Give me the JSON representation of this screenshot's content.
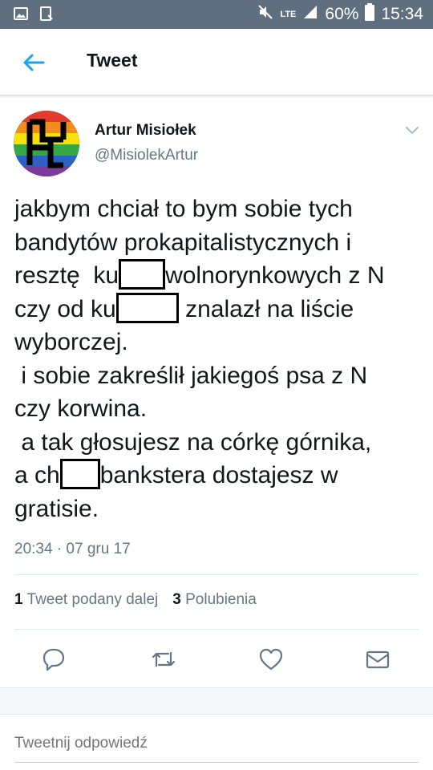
{
  "status_bar": {
    "network": "LTE",
    "battery": "60%",
    "time": "15:34"
  },
  "header": {
    "title": "Tweet"
  },
  "tweet": {
    "author_name": "Artur Misiołek",
    "author_handle": "@MisiolekArtur",
    "lines": [
      [
        "jakbym chciał to bym sobie tych"
      ],
      [
        "bandytów prokapitalistycznych i"
      ],
      [
        "resztę  ku",
        "wolnorynkowych z N"
      ],
      [
        "czy od ku",
        " znalazł na liście"
      ],
      [
        "wyborczej."
      ],
      [
        " i sobie zakreślił jakiegoś psa z N"
      ],
      [
        "czy korwina."
      ],
      [
        " a tak głosujesz na córkę górnika,"
      ],
      [
        "a ch",
        "bankstera dostajesz w"
      ],
      [
        "gratisie."
      ]
    ],
    "timestamp": "20:34 · 07 gru 17",
    "retweets_count": "1",
    "retweets_label": "Tweet podany dalej",
    "likes_count": "3",
    "likes_label": "Polubienia"
  },
  "reply": {
    "placeholder": "Tweetnij odpowiedź"
  },
  "icons": {
    "back": "arrow-left-icon",
    "caret": "chevron-down-icon",
    "reply": "reply-icon",
    "retweet": "retweet-icon",
    "like": "heart-icon",
    "message": "envelope-icon"
  },
  "colors": {
    "status_bar": "#5f6f7f",
    "accent": "#1da1f2",
    "secondary_text": "#657786",
    "primary_text": "#14171a"
  }
}
